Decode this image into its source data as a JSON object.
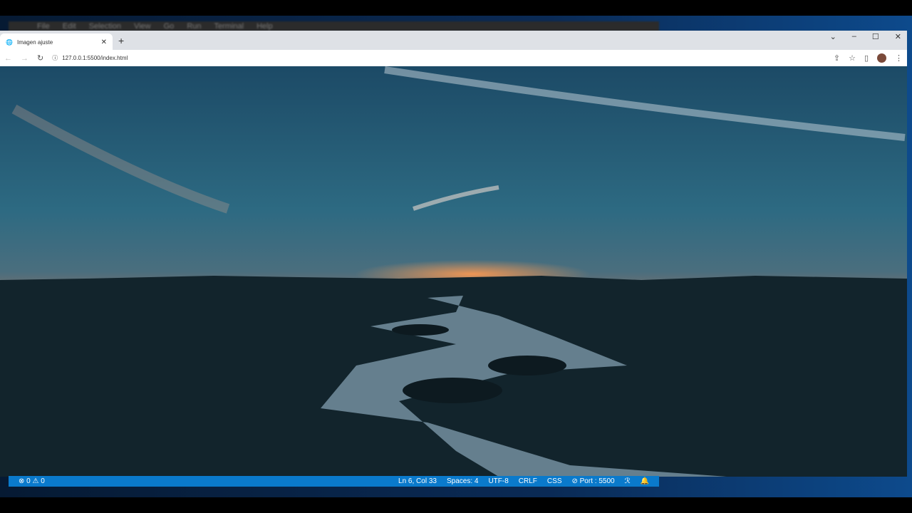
{
  "vscode": {
    "menu": [
      "File",
      "Edit",
      "Selection",
      "View",
      "Go",
      "Run",
      "Terminal",
      "Help"
    ]
  },
  "browser": {
    "tab_title": "Imagen ajuste",
    "new_tab": "+",
    "url": "127.0.0.1:5500/index.html",
    "window_controls": [
      "⌄",
      "–",
      "☐",
      "✕"
    ]
  },
  "statusbar": {
    "problems": "⊗ 0 ⚠ 0",
    "items": [
      "Ln 6, Col 33",
      "Spaces: 4",
      "UTF-8",
      "CRLF",
      "CSS",
      "⊘ Port : 5500",
      "ℛ",
      "🔔"
    ]
  },
  "colors": {
    "status": "#0a7acc",
    "sky_top": "#1f4f6a",
    "sunset": "#f07a3a"
  }
}
